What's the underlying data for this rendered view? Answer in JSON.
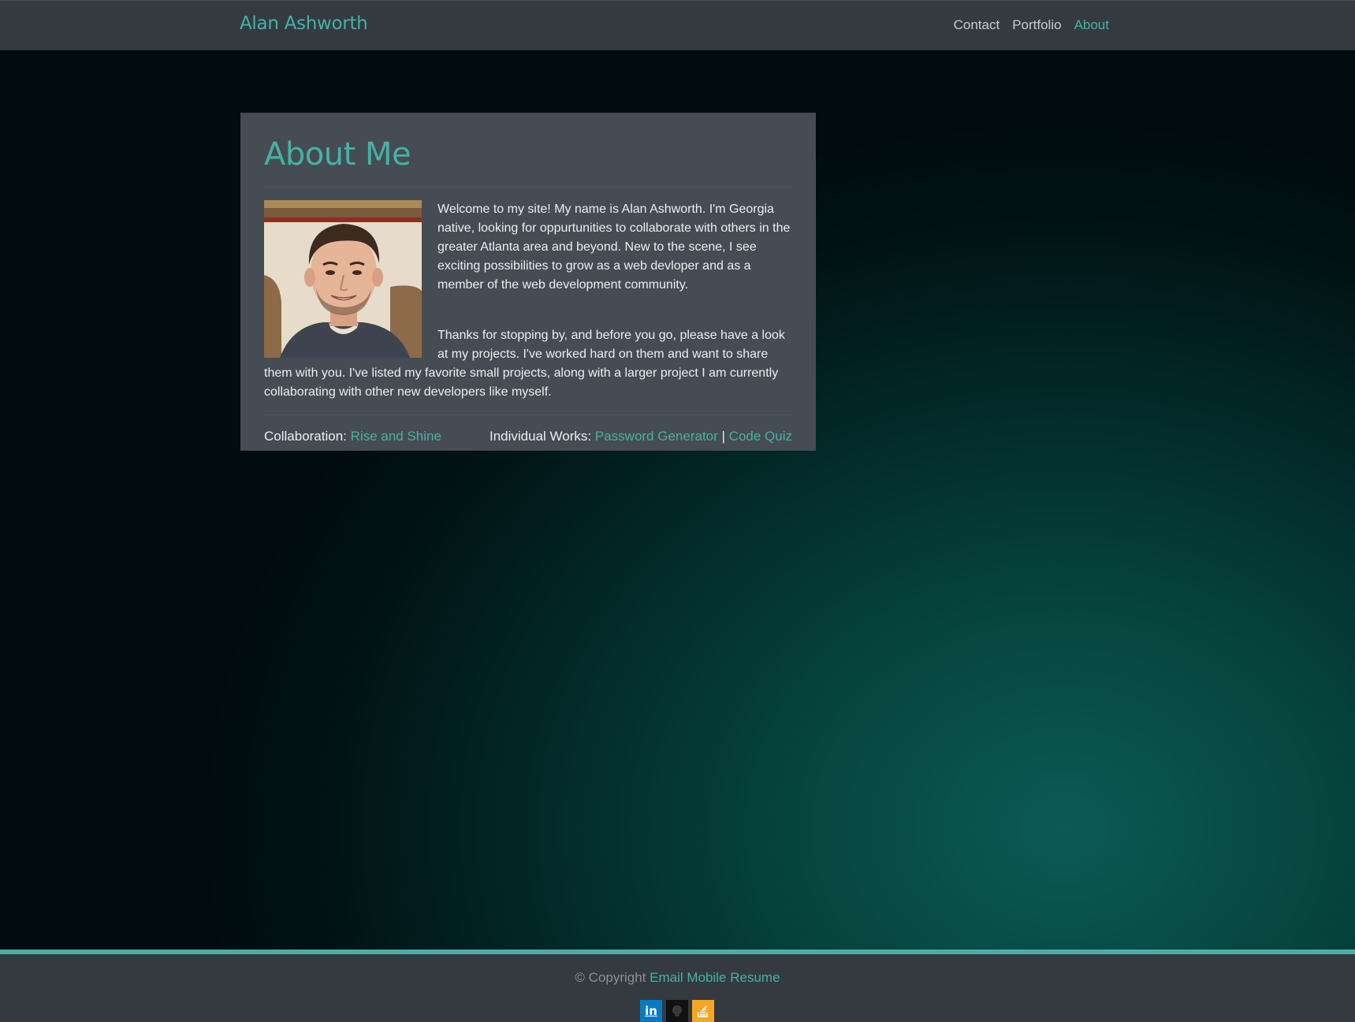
{
  "navbar": {
    "brand": "Alan Ashworth",
    "links": [
      {
        "label": "Contact"
      },
      {
        "label": "Portfolio"
      },
      {
        "label": "About",
        "active": true
      }
    ]
  },
  "about": {
    "title": "About Me",
    "paragraphs": [
      "Welcome to my site! My name is Alan Ashworth. I'm Georgia native, looking for oppurtunities to collaborate with others in the greater Atlanta area and beyond. New to the scene, I see exciting possibilities to grow as a web devloper and as a member of the web development community.",
      "Thanks for stopping by, and before you go, please have a look at my projects. I've worked hard on them and want to share them with you. I've listed my favorite small projects, along with a larger project I am currently collaborating with other new developers like myself."
    ],
    "collaboration_label": "Collaboration:",
    "collaboration_link": "Rise and Shine",
    "individual_label": "Individual Works:",
    "individual_links": [
      "Password Generator",
      "Code Quiz"
    ],
    "separator": "|"
  },
  "footer": {
    "copyright": "© Copyright",
    "links": [
      "Email",
      "Mobile",
      "Resume"
    ],
    "socials": [
      {
        "icon": "linkedin-icon",
        "glyph": "in"
      },
      {
        "icon": "github-icon",
        "glyph": ""
      },
      {
        "icon": "stackoverflow-icon",
        "glyph": ""
      }
    ]
  },
  "colors": {
    "accent": "#45b2a7",
    "navbar": "#353a41",
    "card": "#464c53"
  }
}
